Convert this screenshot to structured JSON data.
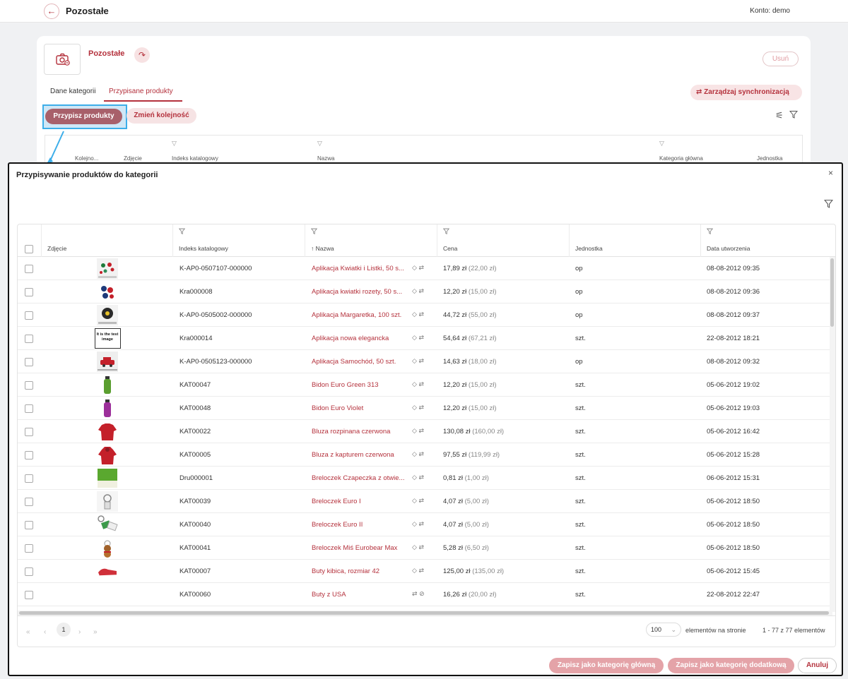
{
  "topbar": {
    "title": "Pozostałe",
    "account_label": "Konto: demo"
  },
  "category": {
    "name": "Pozostałe",
    "delete_label": "Usuń",
    "tabs": [
      "Dane kategorii",
      "Przypisane produkty"
    ],
    "sync_label": "Zarządzaj synchronizacją",
    "assign_label": "Przypisz produkty",
    "order_label": "Zmień kolejność",
    "bg_columns": [
      "Kolejno...",
      "Zdjęcie",
      "Indeks katalogowy",
      "Nazwa",
      "Kategoria główna",
      "Jednostka"
    ]
  },
  "modal": {
    "title": "Przypisywanie produktów do kategorii",
    "columns": {
      "photo": "Zdjęcie",
      "index": "Indeks katalogowy",
      "name": "Nazwa",
      "price": "Cena",
      "unit": "Jednostka",
      "created": "Data utworzenia"
    },
    "sort_indicator": "↑",
    "rows": [
      {
        "index": "K-AP0-0507107-000000",
        "name": "Aplikacja Kwiatki i Listki, 50 s...",
        "price": "17,89 zł",
        "price_gross": "(22,00 zł)",
        "unit": "op",
        "created": "08-08-2012 09:35",
        "thumb": "flowers-leaves"
      },
      {
        "index": "Kra000008",
        "name": "Aplikacja kwiatki rozety, 50 s...",
        "price": "12,20 zł",
        "price_gross": "(15,00 zł)",
        "unit": "op",
        "created": "08-08-2012 09:36",
        "thumb": "rosettes"
      },
      {
        "index": "K-AP0-0505002-000000",
        "name": "Aplikacja Margaretka, 100 szt.",
        "price": "44,72 zł",
        "price_gross": "(55,00 zł)",
        "unit": "op",
        "created": "08-08-2012 09:37",
        "thumb": "daisy"
      },
      {
        "index": "Kra000014",
        "name": "Aplikacja nowa elegancka",
        "price": "54,64 zł",
        "price_gross": "(67,21 zł)",
        "unit": "szt.",
        "created": "22-08-2012 18:21",
        "thumb": "test-image",
        "thumb_text": "It is the test image"
      },
      {
        "index": "K-AP0-0505123-000000",
        "name": "Aplikacja Samochód, 50 szt.",
        "price": "14,63 zł",
        "price_gross": "(18,00 zł)",
        "unit": "op",
        "created": "08-08-2012 09:32",
        "thumb": "car"
      },
      {
        "index": "KAT00047",
        "name": "Bidon Euro Green 313",
        "price": "12,20 zł",
        "price_gross": "(15,00 zł)",
        "unit": "szt.",
        "created": "05-06-2012 19:02",
        "thumb": "bottle-green"
      },
      {
        "index": "KAT00048",
        "name": "Bidon Euro Violet",
        "price": "12,20 zł",
        "price_gross": "(15,00 zł)",
        "unit": "szt.",
        "created": "05-06-2012 19:03",
        "thumb": "bottle-violet"
      },
      {
        "index": "KAT00022",
        "name": "Bluza rozpinana czerwona",
        "price": "130,08 zł",
        "price_gross": "(160,00 zł)",
        "unit": "szt.",
        "created": "05-06-2012 16:42",
        "thumb": "sweatshirt"
      },
      {
        "index": "KAT00005",
        "name": "Bluza z kapturem czerwona",
        "price": "97,55 zł",
        "price_gross": "(119,99 zł)",
        "unit": "szt.",
        "created": "05-06-2012 15:28",
        "thumb": "hoodie"
      },
      {
        "index": "Dru000001",
        "name": "Breloczek Czapeczka z otwie...",
        "price": "0,81 zł",
        "price_gross": "(1,00 zł)",
        "unit": "szt.",
        "created": "06-06-2012 15:31",
        "thumb": "keychain-green"
      },
      {
        "index": "KAT00039",
        "name": "Breloczek Euro I",
        "price": "4,07 zł",
        "price_gross": "(5,00 zł)",
        "unit": "szt.",
        "created": "05-06-2012 18:50",
        "thumb": "keyring"
      },
      {
        "index": "KAT00040",
        "name": "Breloczek Euro II",
        "price": "4,07 zł",
        "price_gross": "(5,00 zł)",
        "unit": "szt.",
        "created": "05-06-2012 18:50",
        "thumb": "keyrings"
      },
      {
        "index": "KAT00041",
        "name": "Breloczek Miś Eurobear Max",
        "price": "5,28 zł",
        "price_gross": "(6,50 zł)",
        "unit": "szt.",
        "created": "05-06-2012 18:50",
        "thumb": "bear"
      },
      {
        "index": "KAT00007",
        "name": "Buty kibica, rozmiar 42",
        "price": "125,00 zł",
        "price_gross": "(135,00 zł)",
        "unit": "szt.",
        "created": "05-06-2012 15:45",
        "thumb": "shoes"
      },
      {
        "index": "KAT00060",
        "name": "Buty z USA",
        "price": "16,26 zł",
        "price_gross": "(20,00 zł)",
        "unit": "szt.",
        "created": "22-08-2012 22:47",
        "thumb": "none"
      }
    ],
    "pager": {
      "current": "1",
      "page_size": "100",
      "page_size_label": "elementów na stronie",
      "info": "1 - 77 z 77 elementów"
    },
    "buttons": {
      "save_main": "Zapisz jako kategorię główną",
      "save_extra": "Zapisz jako kategorię dodatkową",
      "cancel": "Anuluj"
    }
  },
  "colors": {
    "accent": "#b4313c",
    "accent_light": "#f7e2e3",
    "highlight": "#3daee9"
  }
}
